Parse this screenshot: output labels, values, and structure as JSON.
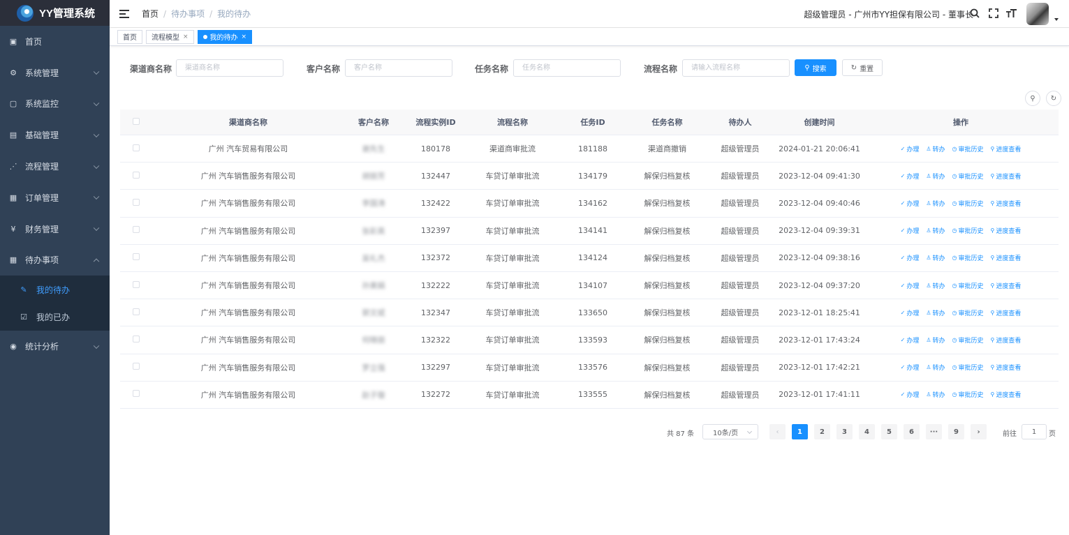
{
  "app": {
    "title": "YY管理系统"
  },
  "sidebar": {
    "items": [
      {
        "label": "首页",
        "icon": "dashboard-icon"
      },
      {
        "label": "系统管理",
        "icon": "gear-icon"
      },
      {
        "label": "系统监控",
        "icon": "monitor-icon"
      },
      {
        "label": "基础管理",
        "icon": "server-icon"
      },
      {
        "label": "流程管理",
        "icon": "workflow-icon"
      },
      {
        "label": "订单管理",
        "icon": "document-icon"
      },
      {
        "label": "财务管理",
        "icon": "yen-icon"
      },
      {
        "label": "待办事项",
        "icon": "todo-icon"
      }
    ],
    "submenu": [
      {
        "label": "我的待办",
        "icon": "edit-icon"
      },
      {
        "label": "我的已办",
        "icon": "checkbox-icon"
      }
    ],
    "last_item": {
      "label": "统计分析",
      "icon": "chart-icon"
    }
  },
  "header": {
    "breadcrumb": [
      "首页",
      "待办事项",
      "我的待办"
    ],
    "separator": "/",
    "user_info": "超级管理员 - 广州市YY担保有限公司 - 董事长"
  },
  "tags": [
    {
      "label": "首页"
    },
    {
      "label": "流程模型",
      "close": "×"
    },
    {
      "label": "我的待办",
      "close": "×"
    }
  ],
  "search": {
    "fields": [
      {
        "label": "渠道商名称",
        "placeholder": "渠道商名称"
      },
      {
        "label": "客户名称",
        "placeholder": "客户名称"
      },
      {
        "label": "任务名称",
        "placeholder": "任务名称"
      },
      {
        "label": "流程名称",
        "placeholder": "请输入流程名称"
      }
    ],
    "search_label": "搜索",
    "reset_label": "重置"
  },
  "table": {
    "columns": [
      "渠道商名称",
      "客户名称",
      "流程实例ID",
      "流程名称",
      "任务ID",
      "任务名称",
      "待办人",
      "创建时间",
      "操作"
    ],
    "rows": [
      {
        "channel": "广州 汽车贸易有限公司",
        "customer": "谢先生",
        "instance_id": "180178",
        "process": "渠道商审批流",
        "task_id": "181188",
        "task": "渠道商撤销",
        "assignee": "超级管理员",
        "created": "2024-01-21 20:06:41"
      },
      {
        "channel": "广州 汽车销售服务有限公司",
        "customer": "胡丽芳",
        "instance_id": "132447",
        "process": "车贷订单审批流",
        "task_id": "134179",
        "task": "解保归档复核",
        "assignee": "超级管理员",
        "created": "2023-12-04 09:41:30"
      },
      {
        "channel": "广州 汽车销售服务有限公司",
        "customer": "李国涛",
        "instance_id": "132422",
        "process": "车贷订单审批流",
        "task_id": "134162",
        "task": "解保归档复核",
        "assignee": "超级管理员",
        "created": "2023-12-04 09:40:46"
      },
      {
        "channel": "广州 汽车销售服务有限公司",
        "customer": "张彩英",
        "instance_id": "132397",
        "process": "车贷订单审批流",
        "task_id": "134141",
        "task": "解保归档复核",
        "assignee": "超级管理员",
        "created": "2023-12-04 09:39:31"
      },
      {
        "channel": "广州 汽车销售服务有限公司",
        "customer": "吴礼杰",
        "instance_id": "132372",
        "process": "车贷订单审批流",
        "task_id": "134124",
        "task": "解保归档复核",
        "assignee": "超级管理员",
        "created": "2023-12-04 09:38:16"
      },
      {
        "channel": "广州 汽车销售服务有限公司",
        "customer": "孙美娟",
        "instance_id": "132222",
        "process": "车贷订单审批流",
        "task_id": "134107",
        "task": "解保归档复核",
        "assignee": "超级管理员",
        "created": "2023-12-04 09:37:20"
      },
      {
        "channel": "广州 汽车销售服务有限公司",
        "customer": "郭文斌",
        "instance_id": "132347",
        "process": "车贷订单审批流",
        "task_id": "133650",
        "task": "解保归档复核",
        "assignee": "超级管理员",
        "created": "2023-12-01 18:25:41"
      },
      {
        "channel": "广州 汽车销售服务有限公司",
        "customer": "何晓丽",
        "instance_id": "132322",
        "process": "车贷订单审批流",
        "task_id": "133593",
        "task": "解保归档复核",
        "assignee": "超级管理员",
        "created": "2023-12-01 17:43:24"
      },
      {
        "channel": "广州 汽车销售服务有限公司",
        "customer": "罗立强",
        "instance_id": "132297",
        "process": "车贷订单审批流",
        "task_id": "133576",
        "task": "解保归档复核",
        "assignee": "超级管理员",
        "created": "2023-12-01 17:42:21"
      },
      {
        "channel": "广州 汽车销售服务有限公司",
        "customer": "赵子璇",
        "instance_id": "132272",
        "process": "车贷订单审批流",
        "task_id": "133555",
        "task": "解保归档复核",
        "assignee": "超级管理员",
        "created": "2023-12-01 17:41:11"
      }
    ],
    "actions": [
      {
        "label": "办理",
        "icon": "check-icon"
      },
      {
        "label": "转办",
        "icon": "user-icon"
      },
      {
        "label": "审批历史",
        "icon": "clock-icon"
      },
      {
        "label": "进度查看",
        "icon": "search-icon"
      }
    ]
  },
  "pagination": {
    "total_text": "共 87 条",
    "page_size": "10条/页",
    "pages": [
      "1",
      "2",
      "3",
      "4",
      "5",
      "6",
      "···",
      "9"
    ],
    "current": "1",
    "goto_label": "前往",
    "goto_value": "1",
    "page_suffix": "页"
  },
  "colors": {
    "primary": "#1890ff",
    "sidebar": "#304156",
    "submenu": "#1f2d3d"
  }
}
